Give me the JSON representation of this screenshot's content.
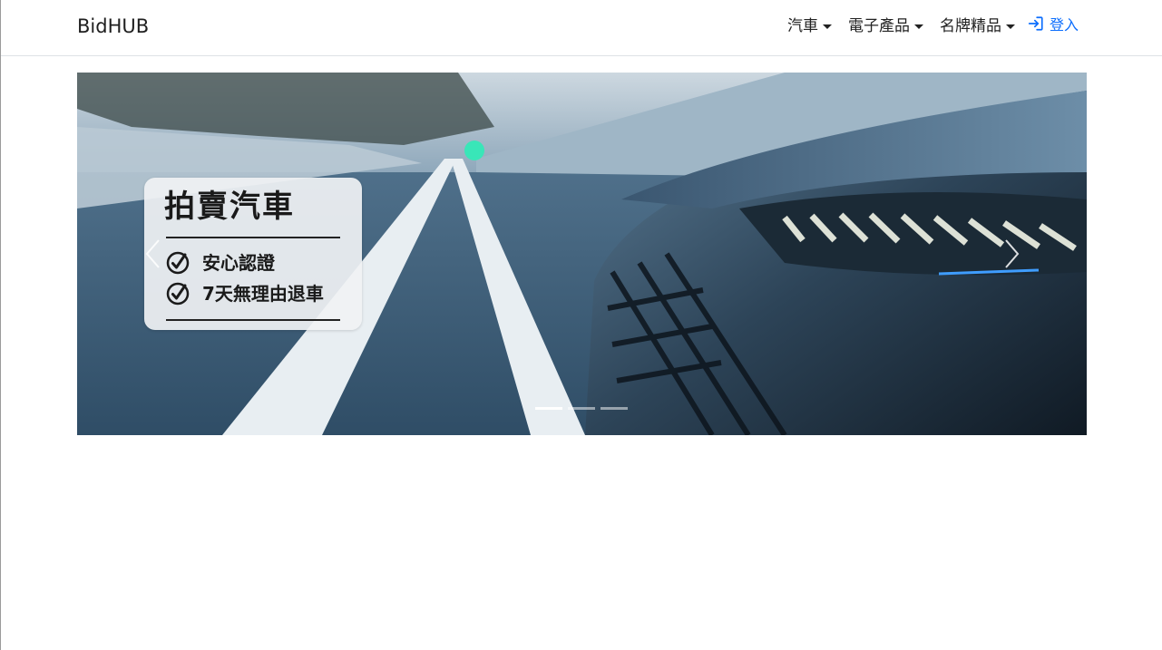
{
  "navbar": {
    "brand": "BidHUB",
    "items": [
      {
        "label": "汽車"
      },
      {
        "label": "電子產品"
      },
      {
        "label": "名牌精品"
      }
    ],
    "login_label": "登入"
  },
  "carousel": {
    "slide_card": {
      "title": "拍賣汽車",
      "features": [
        "安心認證",
        "7天無理由退車"
      ]
    },
    "indicator_count": 3,
    "active_index": 0
  },
  "colors": {
    "link": "#0d6efd",
    "text": "#222222",
    "border": "#dee2e6"
  }
}
